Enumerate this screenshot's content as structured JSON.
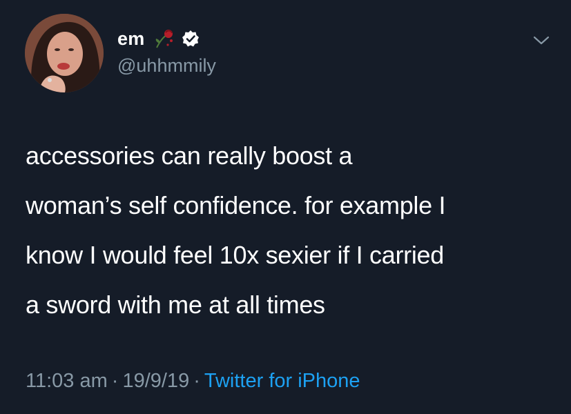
{
  "user": {
    "display_name": "em",
    "handle": "@uhhmmily",
    "name_emoji_icon": "wilted-rose-icon",
    "verified_icon": "verified-badge-icon"
  },
  "tweet": {
    "lines": [
      "accessories can really boost a",
      "woman’s self confidence. for example I",
      "know I would feel 10x sexier if I carried",
      "a sword with me at all times"
    ]
  },
  "meta": {
    "time": "11:03 am",
    "separator": "·",
    "date": "19/9/19",
    "source": "Twitter for iPhone"
  },
  "colors": {
    "background": "#151c28",
    "secondary_text": "#8899a6",
    "link": "#1da1f2",
    "verified": "#ffffff"
  }
}
